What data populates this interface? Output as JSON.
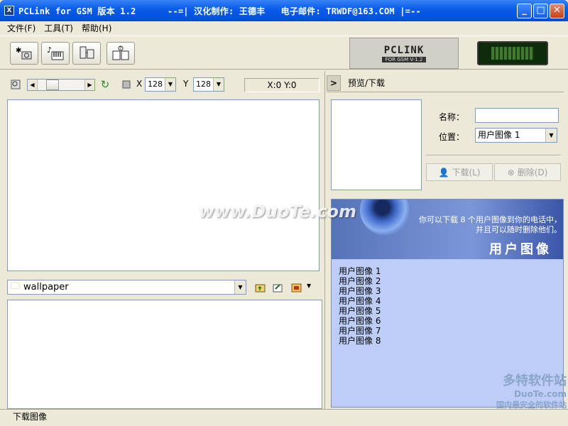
{
  "window": {
    "title": "PCLink for GSM 版本 1.2      --=| 汉化制作: 王德丰   电子邮件: TRWDF@163.COM |=--"
  },
  "menu": [
    {
      "label": "文件(F)"
    },
    {
      "label": "工具(T)"
    },
    {
      "label": "帮助(H)"
    }
  ],
  "logo": {
    "main": "PCLINK",
    "sub": "FOR GSM V-1.2"
  },
  "controls": {
    "x_label": "X",
    "x_value": "128",
    "y_label": "Y",
    "y_value": "128",
    "coords": "X:0  Y:0"
  },
  "folder": {
    "value": "wallpaper"
  },
  "right": {
    "header": "预览/下载",
    "name_label": "名称：",
    "position_label": "位置：",
    "position_value": "用户图像 1",
    "download_button": "下载(L)",
    "delete_button": "删除(D)"
  },
  "info": {
    "message_line1": "你可以下载 8 个用户图像到你的电话中，",
    "message_line2": "并且可以随时删除他们。",
    "title": "用户图像"
  },
  "user_images": [
    "用户图像 1",
    "用户图像 2",
    "用户图像 3",
    "用户图像 4",
    "用户图像 5",
    "用户图像 6",
    "用户图像 7",
    "用户图像 8"
  ],
  "status": {
    "text": "下载图像"
  },
  "watermarks": {
    "center": "www.DuoTe.com",
    "corner1": "多特软件站",
    "corner2": "DuoTe.com",
    "corner3": "国内最安全的软件站"
  }
}
